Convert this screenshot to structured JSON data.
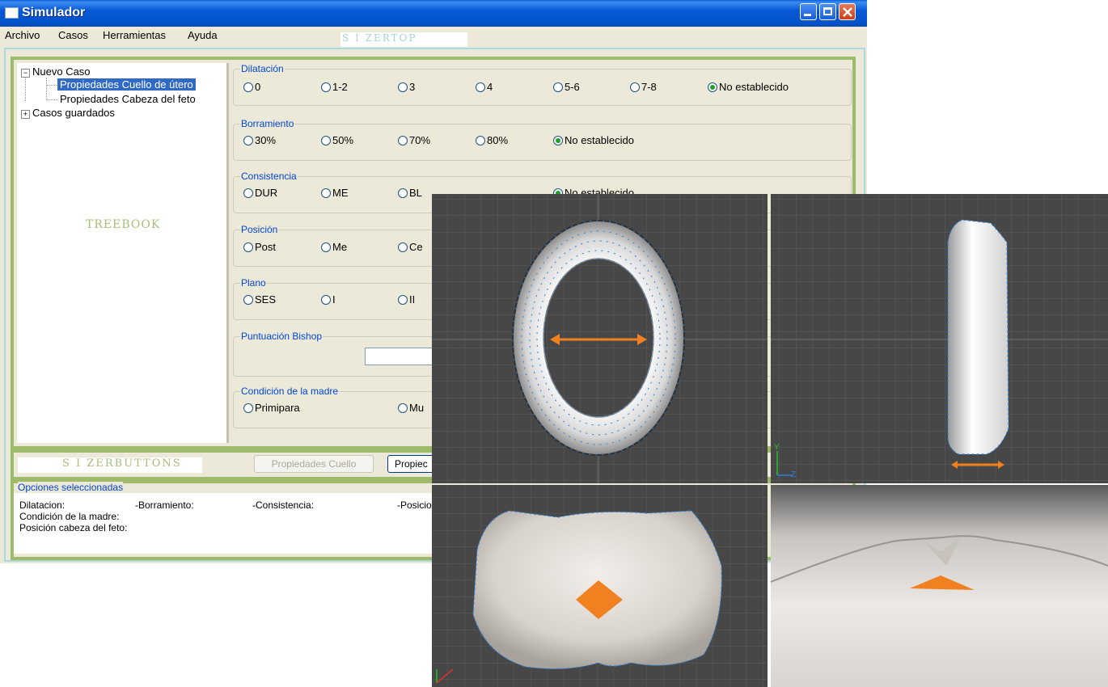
{
  "window": {
    "title": "Simulador"
  },
  "menu": [
    "Archivo",
    "Casos",
    "Herramientas",
    "Ayuda"
  ],
  "labels": {
    "sizertop": "S I ZERTOP",
    "treebook": "TREEBOOK",
    "sizerbuttons": "S I ZERBUTTONS"
  },
  "tree": {
    "root": "Nuevo Caso",
    "children": [
      "Propiedades Cuello de útero",
      "Propiedades Cabeza del feto"
    ],
    "saved": "Casos guardados",
    "selected": "Propiedades Cuello de útero"
  },
  "groups": {
    "dilatacion": {
      "title": "Dilatación",
      "options": [
        "0",
        "1-2",
        "3",
        "4",
        "5-6",
        "7-8",
        "No establecido"
      ],
      "selected": "No establecido"
    },
    "borramiento": {
      "title": "Borramiento",
      "options": [
        "30%",
        "50%",
        "70%",
        "80%",
        "No establecido"
      ],
      "selected": "No establecido"
    },
    "consistencia": {
      "title": "Consistencia",
      "options": [
        "DUR",
        "ME",
        "BL",
        "No establecido"
      ],
      "selected": "No establecido"
    },
    "posicion": {
      "title": "Posición",
      "options": [
        "Post",
        "Me",
        "Ce"
      ]
    },
    "plano": {
      "title": "Plano",
      "options": [
        "SES",
        "I",
        "II"
      ]
    },
    "bishop": {
      "title": "Puntuación Bishop"
    },
    "condicion": {
      "title": "Condición de la madre",
      "options": [
        "Primipara",
        "Mu"
      ]
    }
  },
  "buttons": {
    "cuello": "Propiedades Cuello",
    "cabeza": "Propiec"
  },
  "opciones": {
    "title": "Opciones seleccionadas",
    "line1": [
      "Dilatacion:",
      "-Borramiento:",
      "-Consistencia:",
      "-Posicio"
    ],
    "line2": "Condición de la madre:",
    "line3": "Posición cabeza del feto:"
  },
  "viewport_axes": {
    "side": [
      "Y",
      "Z"
    ]
  },
  "colors": {
    "accent": "#f08020",
    "vertex": "#2a7fd8",
    "green_border": "#9dbb6a",
    "title_blue": "#0058e0"
  }
}
